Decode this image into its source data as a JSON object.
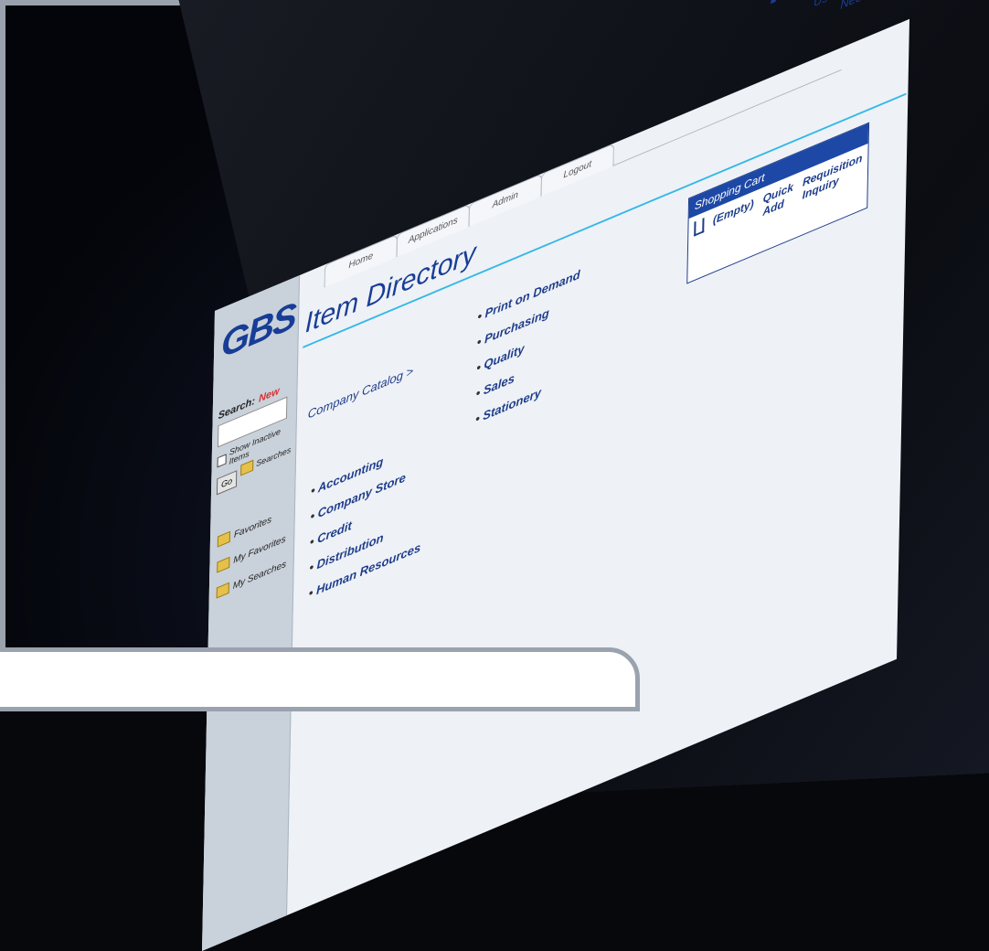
{
  "logo": "GBS",
  "brand": {
    "title": "MyGBS",
    "user": "User: Trista Todd",
    "help": "Need Help?"
  },
  "tabs": [
    "Home",
    "Applications",
    "Admin",
    "Logout"
  ],
  "page_title": "Item Directory",
  "sidebar": {
    "search_label": "Search:",
    "search_new": "New",
    "show_inactive": "Show Inactive Items",
    "go": "Go",
    "searches": "Searches",
    "links": [
      "Favorites",
      "My Favorites",
      "My Searches"
    ]
  },
  "cart": {
    "title": "Shopping Cart",
    "empty": "(Empty)",
    "quick_add": "Quick Add",
    "requisition": "Requisition Inquiry"
  },
  "catalog": "Company Catalog >",
  "left_items": [
    "Accounting",
    "Company Store",
    "Credit",
    "Distribution",
    "Human Resources"
  ],
  "right_items": [
    "Print on Demand",
    "Purchasing",
    "Quality",
    "Sales",
    "Stationery"
  ]
}
